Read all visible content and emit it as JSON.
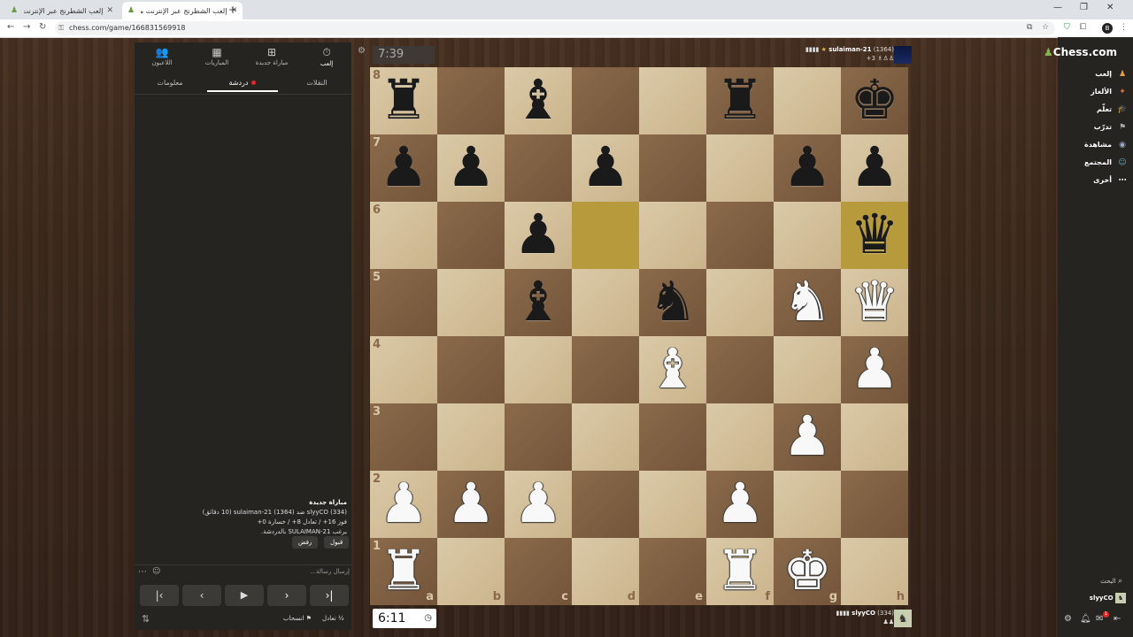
{
  "browser": {
    "tabs": [
      {
        "title": "إلعب الشطرنج عبر الإنترنت مجانًا",
        "active": false
      },
      {
        "title": "إلعب الشطرنج عبر الإنترنت مجانًا",
        "active": true
      }
    ],
    "url": "chess.com/game/166831569918"
  },
  "panel": {
    "top_tabs": [
      {
        "label": "إلعب",
        "icon": "stopwatch-icon"
      },
      {
        "label": "مباراة جديدة",
        "icon": "plus-icon"
      },
      {
        "label": "المباريات",
        "icon": "board-icon"
      },
      {
        "label": "اللاعبون",
        "icon": "players-icon"
      }
    ],
    "sub_tabs": [
      {
        "label": "النقلات"
      },
      {
        "label": "دردشة"
      },
      {
        "label": "معلومات"
      }
    ],
    "game_info": {
      "title": "مباراة جديدة",
      "line1": "slyyCO (334) ضد sulaiman-21 (1364) (10 دقائق)",
      "line2": "فوز 16+ / تعادل 8+ / خسارة 0+",
      "line3": "يرغب SULAIMAN-21 بالدردشة."
    },
    "accept_label": "قبول",
    "decline_label": "رفض",
    "chat_placeholder": "إرسال رسالة...",
    "draw_label": "تعادل",
    "resign_label": "انسحاب"
  },
  "clocks": {
    "top": "7:39",
    "bottom": "6:11"
  },
  "players": {
    "top": {
      "name": "sulaiman-21",
      "rating": "(1364)",
      "extra": "3+"
    },
    "bottom": {
      "name": "slyyCO",
      "rating": "(334)"
    }
  },
  "board": {
    "files": [
      "a",
      "b",
      "c",
      "d",
      "e",
      "f",
      "g",
      "h"
    ],
    "ranks": [
      "8",
      "7",
      "6",
      "5",
      "4",
      "3",
      "2",
      "1"
    ],
    "highlighted": [
      "d6",
      "h6"
    ],
    "pieces": [
      {
        "square": "a8",
        "piece": "black-rook"
      },
      {
        "square": "c8",
        "piece": "black-bishop"
      },
      {
        "square": "f8",
        "piece": "black-rook"
      },
      {
        "square": "h8",
        "piece": "black-king"
      },
      {
        "square": "a7",
        "piece": "black-pawn"
      },
      {
        "square": "b7",
        "piece": "black-pawn"
      },
      {
        "square": "d7",
        "piece": "black-pawn"
      },
      {
        "square": "g7",
        "piece": "black-pawn"
      },
      {
        "square": "h7",
        "piece": "black-pawn"
      },
      {
        "square": "c6",
        "piece": "black-pawn"
      },
      {
        "square": "h6",
        "piece": "black-queen"
      },
      {
        "square": "c5",
        "piece": "black-bishop"
      },
      {
        "square": "e5",
        "piece": "black-knight"
      },
      {
        "square": "g5",
        "piece": "white-knight"
      },
      {
        "square": "h5",
        "piece": "white-queen"
      },
      {
        "square": "e4",
        "piece": "white-bishop"
      },
      {
        "square": "h4",
        "piece": "white-pawn"
      },
      {
        "square": "g3",
        "piece": "white-pawn"
      },
      {
        "square": "a2",
        "piece": "white-pawn"
      },
      {
        "square": "b2",
        "piece": "white-pawn"
      },
      {
        "square": "c2",
        "piece": "white-pawn"
      },
      {
        "square": "f2",
        "piece": "white-pawn"
      },
      {
        "square": "a1",
        "piece": "white-rook"
      },
      {
        "square": "f1",
        "piece": "white-rook"
      },
      {
        "square": "g1",
        "piece": "white-king"
      }
    ]
  },
  "sidebar": {
    "logo": "Chess.com",
    "items": [
      {
        "label": "إلعب",
        "icon": "play-icon"
      },
      {
        "label": "الألغاز",
        "icon": "puzzle-icon"
      },
      {
        "label": "تعلّم",
        "icon": "learn-icon"
      },
      {
        "label": "تدرّب",
        "icon": "practice-icon"
      },
      {
        "label": "مشاهدة",
        "icon": "watch-icon"
      },
      {
        "label": "المجتمع",
        "icon": "community-icon"
      },
      {
        "label": "أخرى",
        "icon": "more-icon"
      }
    ],
    "search_label": "البحث",
    "username": "slyyCO",
    "notification_count": "1"
  },
  "colors": {
    "panel_bg": "#262421",
    "light_square": "#dac9a7",
    "dark_square": "#8a6a4a",
    "highlight": "#b79a3b",
    "brand_green": "#81b64c"
  }
}
